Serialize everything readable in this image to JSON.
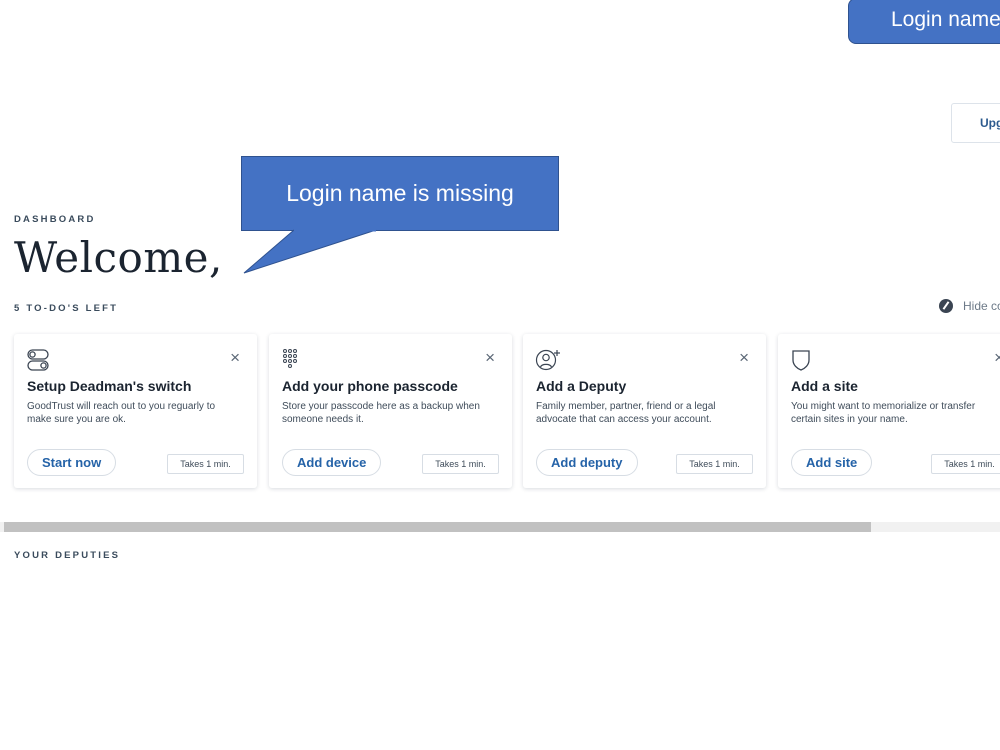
{
  "annotations": {
    "top_callout": "Login name is missing",
    "mid_callout": "Login name is missing"
  },
  "header": {
    "upgrade_label": "Upgrade"
  },
  "dashboard": {
    "kicker": "DASHBOARD",
    "welcome": "Welcome,",
    "todos_left": "5 TO-DO'S LEFT",
    "hide_label": "Hide completed"
  },
  "cards": [
    {
      "icon": "toggle-switch-icon",
      "title": "Setup Deadman's switch",
      "description": "GoodTrust will reach out to you reguarly to make sure you are ok.",
      "action": "Start now",
      "time": "Takes 1 min."
    },
    {
      "icon": "keypad-icon",
      "title": "Add your phone passcode",
      "description": "Store your passcode here as a backup when someone needs it.",
      "action": "Add device",
      "time": "Takes 1 min."
    },
    {
      "icon": "add-person-icon",
      "title": "Add a Deputy",
      "description": "Family member, partner, friend or a legal advocate that can access your account.",
      "action": "Add deputy",
      "time": "Takes 1 min."
    },
    {
      "icon": "shield-icon",
      "title": "Add a site",
      "description": "You might want to memorialize or transfer certain sites in your name.",
      "action": "Add site",
      "time": "Takes 1 min."
    }
  ],
  "deputies": {
    "heading": "YOUR DEPUTIES"
  },
  "close_glyph": "×",
  "colors": {
    "callout": "#4472c4",
    "accent": "#2563a8",
    "text": "#1b2430"
  }
}
